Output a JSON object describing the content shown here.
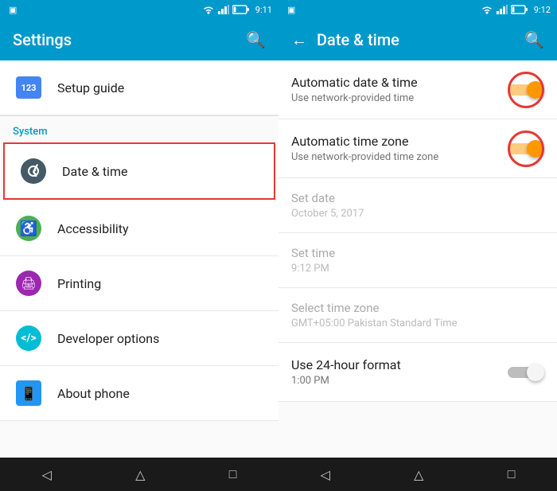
{
  "leftPanel": {
    "statusBar": {
      "time": "9:11",
      "battery": "12%"
    },
    "title": "Settings",
    "searchIcon": "🔍",
    "setupGuide": {
      "label": "Setup guide",
      "icon": "123"
    },
    "systemSection": {
      "label": "System",
      "items": [
        {
          "id": "date-time",
          "label": "Date & time",
          "icon": "clock",
          "highlighted": true
        },
        {
          "id": "accessibility",
          "label": "Accessibility",
          "icon": "accessibility"
        },
        {
          "id": "printing",
          "label": "Printing",
          "icon": "printing"
        },
        {
          "id": "developer-options",
          "label": "Developer options",
          "icon": "developer"
        },
        {
          "id": "about-phone",
          "label": "About phone",
          "icon": "phone"
        }
      ]
    },
    "navBar": {
      "back": "◁",
      "home": "△",
      "recent": "□"
    }
  },
  "rightPanel": {
    "statusBar": {
      "time": "9:12",
      "battery": "12%"
    },
    "title": "Date & time",
    "backIcon": "←",
    "searchIcon": "🔍",
    "items": [
      {
        "id": "auto-date-time",
        "title": "Automatic date & time",
        "subtitle": "Use network-provided time",
        "toggleOn": true,
        "hasCircle": true
      },
      {
        "id": "auto-timezone",
        "title": "Automatic time zone",
        "subtitle": "Use network-provided time zone",
        "toggleOn": true,
        "hasCircle": true
      },
      {
        "id": "set-date",
        "title": "Set date",
        "subtitle": "October 5, 2017",
        "disabled": true
      },
      {
        "id": "set-time",
        "title": "Set time",
        "subtitle": "9:12 PM",
        "disabled": true
      },
      {
        "id": "select-timezone",
        "title": "Select time zone",
        "subtitle": "GMT+05:00 Pakistan Standard Time",
        "disabled": true
      },
      {
        "id": "24hr-format",
        "title": "Use 24-hour format",
        "subtitle": "1:00 PM",
        "toggleOn": false,
        "hasCircle": false
      }
    ],
    "navBar": {
      "back": "◁",
      "home": "△",
      "recent": "□"
    }
  }
}
